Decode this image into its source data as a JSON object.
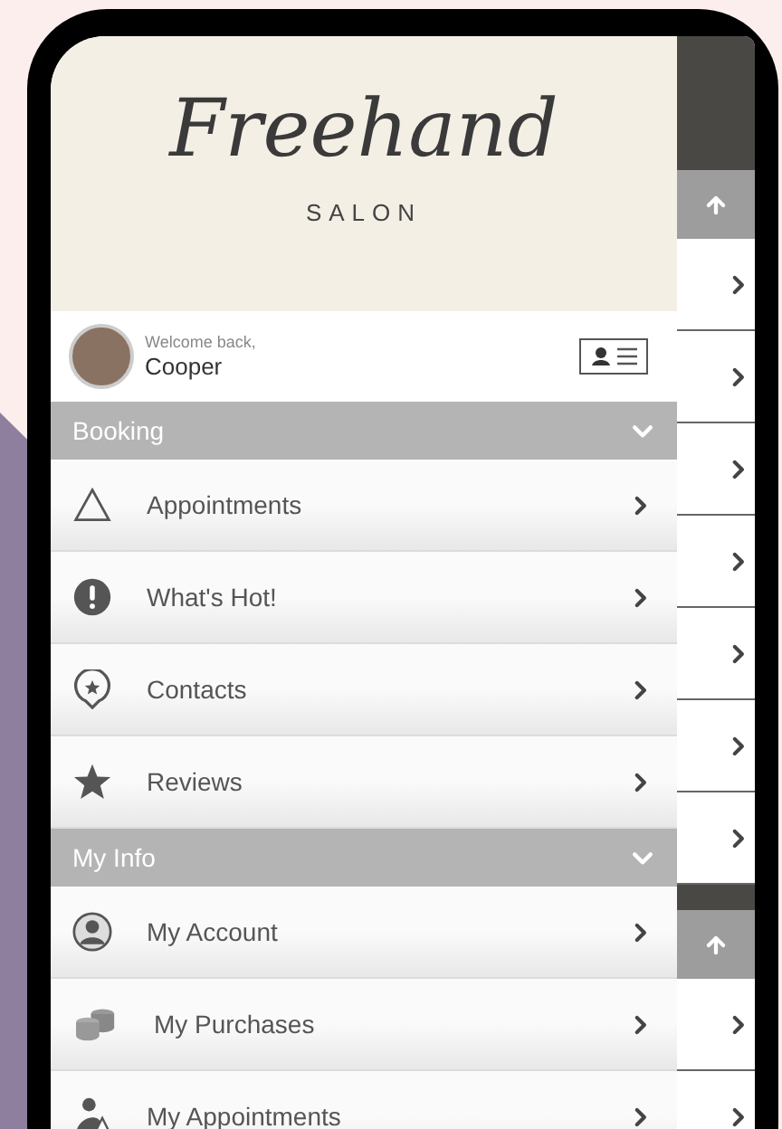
{
  "logo": {
    "script": "Freehand",
    "subtitle": "SALON"
  },
  "user": {
    "greeting": "Welcome back,",
    "name": "Cooper"
  },
  "sections": [
    {
      "title": "Booking",
      "expanded": true,
      "items": [
        {
          "label": "Appointments",
          "kind": "triangle"
        },
        {
          "label": "What's Hot!",
          "kind": "alert"
        },
        {
          "label": "Contacts",
          "kind": "pin"
        },
        {
          "label": "Reviews",
          "kind": "star"
        }
      ]
    },
    {
      "title": "My Info",
      "expanded": true,
      "items": [
        {
          "label": "My Account",
          "kind": "person"
        },
        {
          "label": "My Purchases",
          "kind": "coins"
        },
        {
          "label": "My Appointments",
          "kind": "worker"
        }
      ]
    }
  ]
}
